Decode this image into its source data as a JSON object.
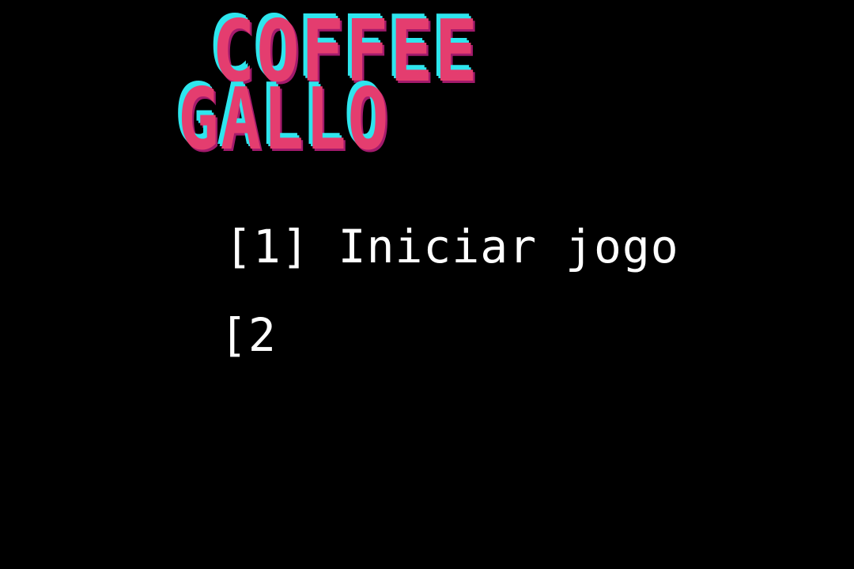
{
  "logo": {
    "line1": "COFFEE",
    "line2": "GALLO"
  },
  "menu": {
    "options": [
      {
        "label": "[1] Iniciar jogo"
      },
      {
        "label": "[2"
      }
    ]
  },
  "colors": {
    "background": "#000000",
    "logo_fill": "#e43d6f",
    "logo_shadow_cyan": "#2ee6ee",
    "logo_shadow_dark": "#a31a6c",
    "menu_text": "#ffffff"
  }
}
